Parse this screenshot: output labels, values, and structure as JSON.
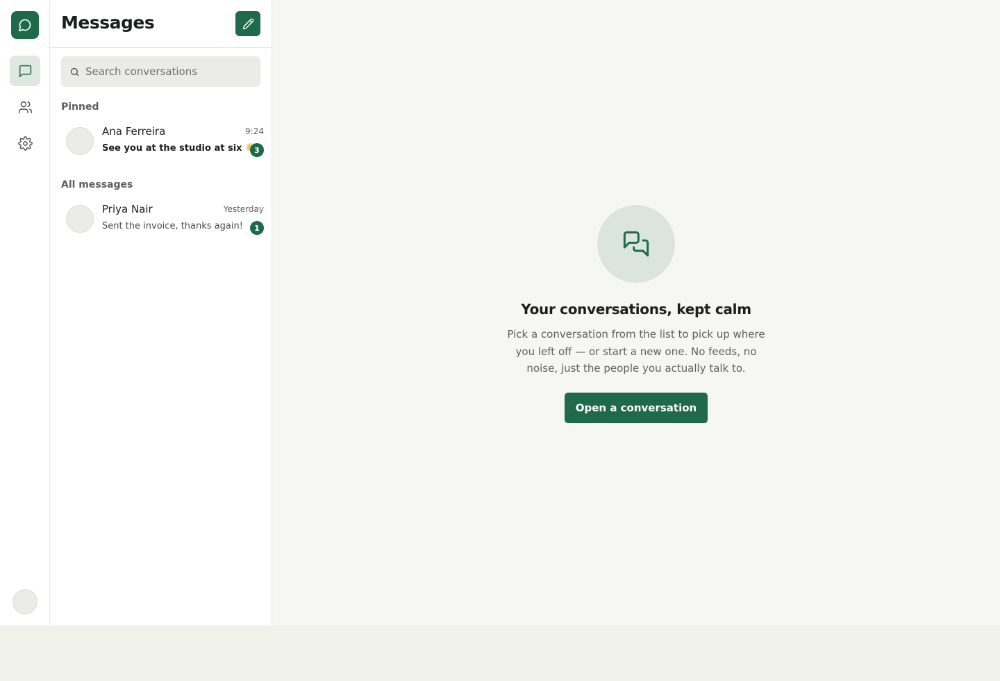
{
  "rail": {
    "logo_icon": "chat-bubble-icon",
    "items": [
      {
        "name": "messages",
        "icon": "message-square-icon",
        "active": true
      },
      {
        "name": "contacts",
        "icon": "users-icon",
        "active": false
      },
      {
        "name": "settings",
        "icon": "gear-icon",
        "active": false
      }
    ]
  },
  "sidebar": {
    "title": "Messages",
    "compose_icon": "pencil-icon",
    "search": {
      "placeholder": "Search conversations",
      "value": ""
    },
    "pinned_label": "Pinned",
    "all_label": "All messages",
    "pinned": [
      {
        "name": "Ana Ferreira",
        "time": "9:24",
        "preview": "See you at the studio at six 👋",
        "unread": "3"
      }
    ],
    "all": [
      {
        "name": "Priya Nair",
        "time": "Yesterday",
        "preview": "Sent the invoice, thanks again!",
        "unread": "1"
      }
    ]
  },
  "main": {
    "empty_icon": "conversations-icon",
    "title": "Your conversations, kept calm",
    "body": "Pick a conversation from the list to pick up where you left off — or start a new one. No feeds, no noise, just the people you actually talk to.",
    "cta": "Open a conversation"
  },
  "colors": {
    "accent": "#1f6a4b",
    "background": "#f6f6f2",
    "accent_soft": "#dce4df"
  }
}
